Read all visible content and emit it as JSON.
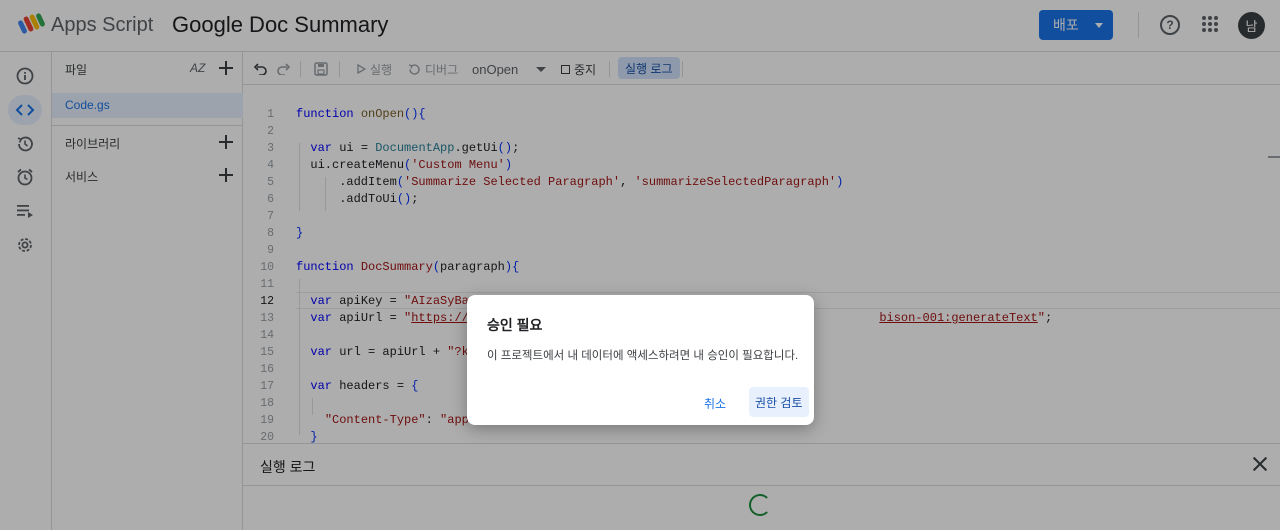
{
  "header": {
    "brand": "Apps Script",
    "project_title": "Google Doc Summary",
    "deploy_label": "배포",
    "avatar_initial": "남"
  },
  "files_panel": {
    "title": "파일",
    "sort_label": "AZ",
    "file": "Code.gs",
    "libraries_label": "라이브러리",
    "services_label": "서비스"
  },
  "toolbar": {
    "run_label": "실행",
    "debug_label": "디버그",
    "function_selected": "onOpen",
    "stop_label": "중지",
    "exec_log_label": "실행 로그"
  },
  "editor": {
    "current_line": 12,
    "line_numbers": [
      "1",
      "2",
      "3",
      "4",
      "5",
      "6",
      "7",
      "8",
      "9",
      "10",
      "11",
      "12",
      "13",
      "14",
      "15",
      "16",
      "17",
      "18",
      "19",
      "20"
    ],
    "lines": [
      "function onOpen(){",
      "",
      "  var ui = DocumentApp.getUi();",
      "  ui.createMenu('Custom Menu')",
      "      .addItem('Summarize Selected Paragraph', 'summarizeSelectedParagraph')",
      "      .addToUi();",
      "",
      "}",
      "",
      "function DocSummary(paragraph){",
      "",
      "  var apiKey = \"AIzaSyBaak",
      "  var apiUrl = \"https://ge...bison-001:generateText\";",
      "",
      "  var url = apiUrl + \"?key",
      "",
      "  var headers = {",
      "",
      "    \"Content-Type\": \"appli",
      "  }"
    ]
  },
  "log_panel": {
    "title": "실행 로그"
  },
  "dialog": {
    "title": "승인 필요",
    "message": "이 프로젝트에서 내 데이터에 액세스하려면 내 승인이 필요합니다.",
    "cancel_label": "취소",
    "review_label": "권한 검토"
  },
  "colors": {
    "accent": "#1a73e8",
    "scrim": "rgba(0,0,0,0.32)",
    "spinner": "#1e8e3e"
  }
}
